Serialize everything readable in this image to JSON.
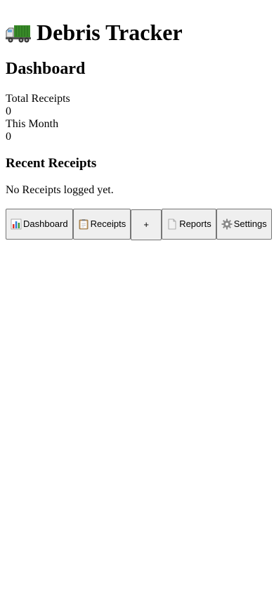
{
  "app": {
    "title": "Debris Tracker",
    "icon": "truck-icon"
  },
  "dashboard": {
    "heading": "Dashboard",
    "stats": [
      {
        "label": "Total Receipts",
        "value": "0"
      },
      {
        "label": "This Month",
        "value": "0"
      }
    ],
    "recent_heading": "Recent Receipts",
    "empty_message": "No Receipts logged yet."
  },
  "nav": {
    "dashboard": {
      "label": "Dashboard",
      "icon": "bar-chart-icon"
    },
    "receipts": {
      "label": "Receipts",
      "icon": "clipboard-icon"
    },
    "add": {
      "label": "+"
    },
    "reports": {
      "label": "Reports",
      "icon": "document-icon"
    },
    "settings": {
      "label": "Settings",
      "icon": "gear-icon"
    }
  },
  "colors": {
    "truck_body": "#3a8a2a",
    "button_bg": "#efefef",
    "button_border": "#767676"
  }
}
